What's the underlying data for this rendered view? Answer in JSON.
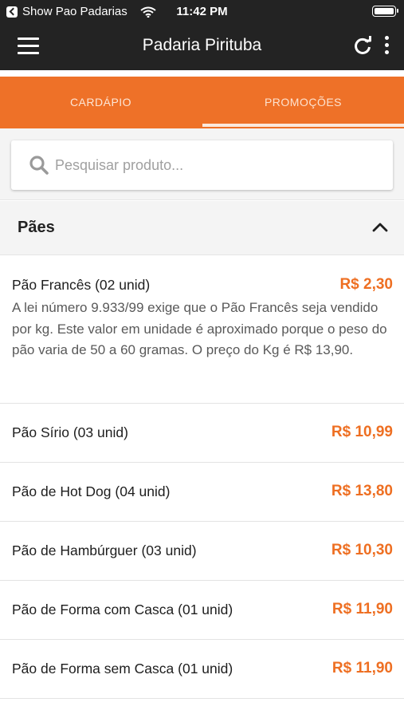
{
  "status_bar": {
    "back_app": "Show Pao Padarias",
    "time": "11:42 PM"
  },
  "toolbar": {
    "title": "Padaria Pirituba"
  },
  "tabs": [
    {
      "label": "CARDÁPIO",
      "selected": false
    },
    {
      "label": "PROMOÇÕES",
      "selected": true
    }
  ],
  "search": {
    "placeholder": "Pesquisar produto...",
    "value": ""
  },
  "section": {
    "title": "Pães",
    "expanded": true
  },
  "items": [
    {
      "name": "Pão Francês (02 unid)",
      "price": "R$ 2,30",
      "description": "A lei número 9.933/99 exige que o Pão Francês seja vendido por kg. Este valor em unidade é aproximado porque o peso do pão varia de 50 a 60 gramas. O preço do Kg é R$ 13,90."
    },
    {
      "name": "Pão Sírio (03 unid)",
      "price": "R$ 10,99"
    },
    {
      "name": "Pão de Hot Dog (04 unid)",
      "price": "R$ 13,80"
    },
    {
      "name": "Pão de Hambúrguer (03 unid)",
      "price": "R$ 10,30"
    },
    {
      "name": "Pão de Forma com Casca (01 unid)",
      "price": "R$ 11,90"
    },
    {
      "name": "Pão de Forma sem Casca (01 unid)",
      "price": "R$ 11,90"
    }
  ],
  "colors": {
    "toolbar": "#232323",
    "accent": "#ee7128",
    "price": "#ee6f22"
  },
  "icons": [
    "back-icon",
    "wifi-icon",
    "battery-icon",
    "menu-icon",
    "refresh-icon",
    "more-vert-icon",
    "search-icon",
    "chevron-up-icon"
  ]
}
